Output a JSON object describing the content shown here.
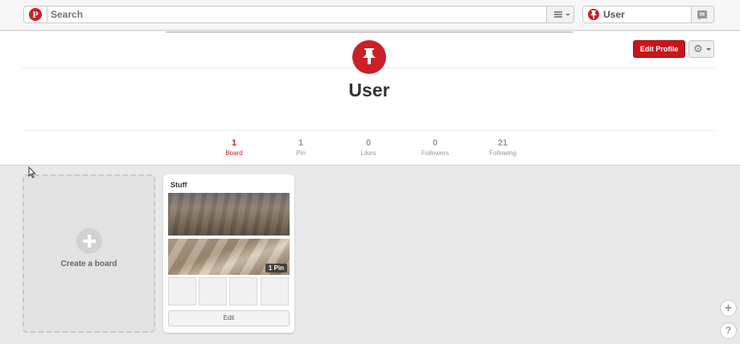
{
  "header": {
    "logo_glyph": "P",
    "search_placeholder": "Search",
    "user_name": "User"
  },
  "profile": {
    "name": "User",
    "edit_profile_label": "Edit Profile",
    "settings_glyph": "⚙",
    "stats": [
      {
        "count": "1",
        "label": "Board",
        "active": true
      },
      {
        "count": "1",
        "label": "Pin",
        "active": false
      },
      {
        "count": "0",
        "label": "Likes",
        "active": false
      },
      {
        "count": "0",
        "label": "Followers",
        "active": false
      },
      {
        "count": "21",
        "label": "Following",
        "active": false
      }
    ]
  },
  "boards": {
    "create_label": "Create a board",
    "items": [
      {
        "title": "Stuff",
        "pin_count": "1 Pin",
        "edit_label": "Edit"
      }
    ]
  },
  "floating": {
    "add_glyph": "+",
    "help_glyph": "?"
  },
  "colors": {
    "brand_red": "#cb2027",
    "background": "#e9e9e9"
  }
}
